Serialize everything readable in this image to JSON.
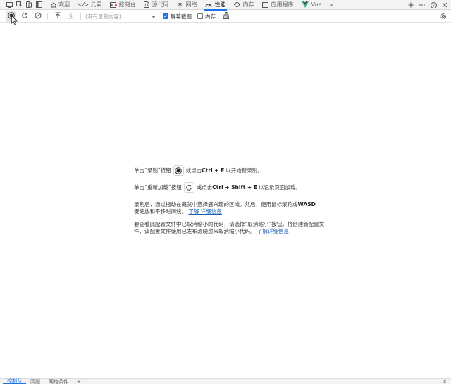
{
  "tabbar": {
    "tabs": [
      {
        "label": "欢迎",
        "icon": "welcome-icon",
        "active": false
      },
      {
        "label": "元素",
        "icon": "elements-icon",
        "active": false
      },
      {
        "label": "控制台",
        "icon": "console-icon",
        "active": false
      },
      {
        "label": "源代码",
        "icon": "sources-icon",
        "active": false
      },
      {
        "label": "网络",
        "icon": "network-icon",
        "active": false
      },
      {
        "label": "性能",
        "icon": "performance-icon",
        "active": true
      },
      {
        "label": "内存",
        "icon": "memory-icon",
        "active": false
      },
      {
        "label": "应用程序",
        "icon": "application-icon",
        "active": false
      },
      {
        "label": "Vue",
        "icon": "vue-icon",
        "active": false
      }
    ],
    "accent_color": "#1a73e8"
  },
  "toolbar": {
    "profile_select_placeholder": "(没有录制内容)",
    "screenshots_label": "屏幕截图",
    "screenshots_checked": true,
    "memory_label": "内存",
    "memory_checked": false
  },
  "landing": {
    "record_prefix": "单击“录制”按钮",
    "record_suffix_1": "或点击",
    "record_shortcut": "Ctrl + E",
    "record_suffix_2": "以开始新录制。",
    "reload_prefix": "单击“重新加载”按钮",
    "reload_suffix_1": "或点击",
    "reload_shortcut": "Ctrl + Shift + E",
    "reload_suffix_2": "以记录页面加载。",
    "hint_text_1": "录制后，通过拖动在概览中选择感兴趣的区域。然后，使用鼠标滚轮或",
    "hint_wasd": "WASD",
    "hint_text_2": "键缩放和平移时间线。",
    "hint_link": "了解 详细信息",
    "sourcemap_text": "要查看此配置文件中已取消缩小的代码，请选择“取消缩小”按钮。将创建新配置文件，该配置文件使用已发布源映射来取消缩小代码。",
    "sourcemap_link": "了解详细信息"
  },
  "drawer": {
    "tabs": [
      "控制台",
      "问题",
      "网络条件"
    ]
  }
}
